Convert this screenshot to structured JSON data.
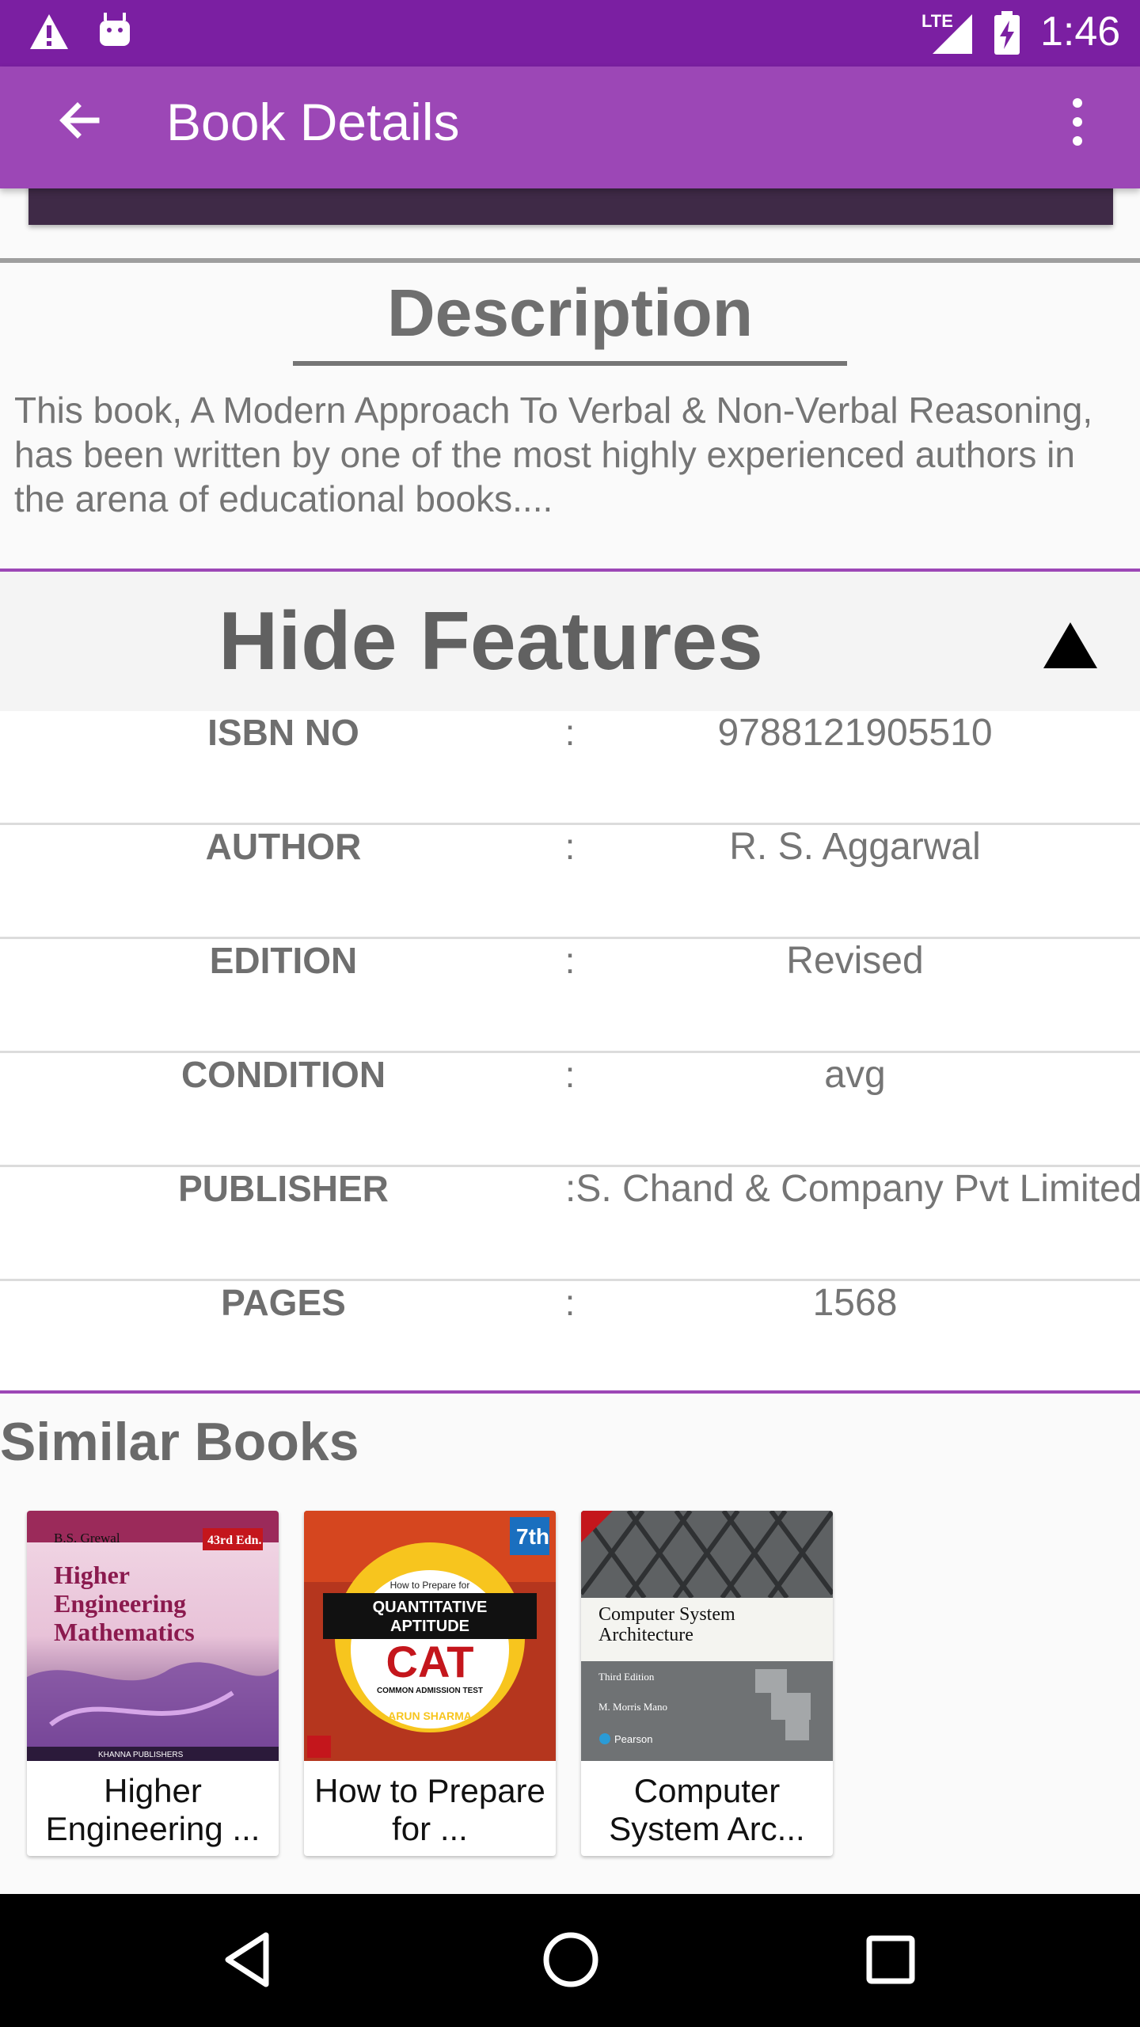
{
  "status_bar": {
    "network": "LTE",
    "time": "1:46"
  },
  "app_bar": {
    "title": "Book Details",
    "back_icon": "arrow-back-icon",
    "menu_icon": "more-vert-icon"
  },
  "description": {
    "heading": "Description",
    "text": "This book, A Modern Approach To Verbal & Non-Verbal Reasoning, has been written by one of the most highly experienced authors in the arena of educational books...."
  },
  "features": {
    "toggle_label": "Hide Features",
    "toggle_icon": "collapse-triangle-icon",
    "separator": ":",
    "rows": [
      {
        "key": "ISBN NO",
        "value": "9788121905510"
      },
      {
        "key": "AUTHOR",
        "value": "R. S. Aggarwal"
      },
      {
        "key": "EDITION",
        "value": "Revised"
      },
      {
        "key": "CONDITION",
        "value": "avg"
      },
      {
        "key": "PUBLISHER",
        "value": ":S. Chand & Company Pvt Limited"
      },
      {
        "key": "PAGES",
        "value": "1568"
      }
    ]
  },
  "similar_books": {
    "heading": "Similar Books",
    "books": [
      {
        "title": "Higher Engineering ...",
        "cover": {
          "author": "B.S. Grewal",
          "edition": "43rd Edn.",
          "line1": "Higher",
          "line2": "Engineering",
          "line3": "Mathematics",
          "publisher": "KHANNA PUBLISHERS"
        }
      },
      {
        "title": "How to Prepare for ...",
        "cover": {
          "edition": "7th",
          "small": "How to Prepare for",
          "line1": "QUANTITATIVE",
          "line2": "APTITUDE",
          "big": "CAT",
          "sub": "COMMON ADMISSION TEST",
          "author": "ARUN SHARMA"
        }
      },
      {
        "title": "Computer System Arc...",
        "cover": {
          "line1": "Computer System",
          "line2": "Architecture",
          "edition": "Third Edition",
          "author": "M. Morris Mano",
          "publisher": "Pearson"
        }
      }
    ]
  },
  "nav_bar": {
    "back": "nav-back-icon",
    "home": "nav-home-icon",
    "recents": "nav-recents-icon"
  },
  "colors": {
    "status_bar": "#7b1fa2",
    "app_bar": "#9c47b6",
    "accent_divider": "#9c47b6"
  }
}
